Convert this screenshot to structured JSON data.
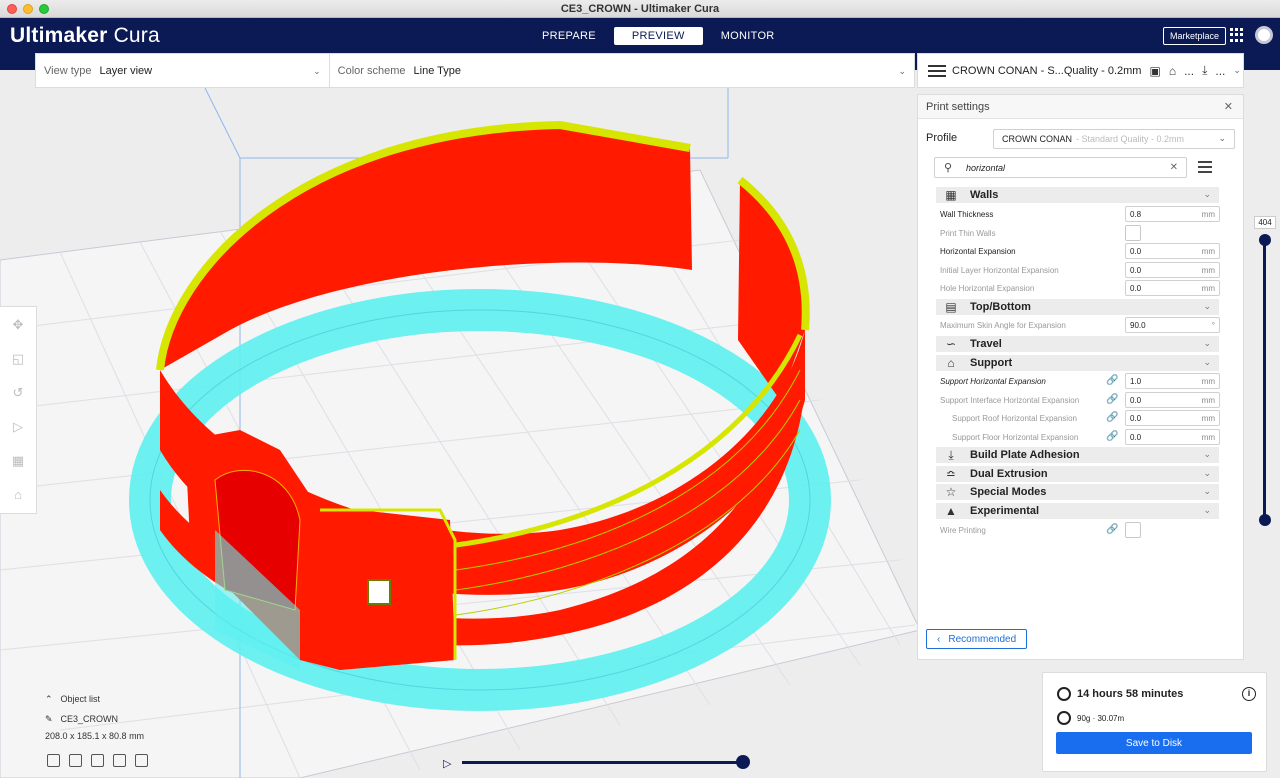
{
  "window": {
    "title": "CE3_CROWN - Ultimaker Cura"
  },
  "header": {
    "logo_brand": "Ultimaker",
    "logo_product": "Cura",
    "stages": [
      {
        "label": "PREPARE",
        "active": false
      },
      {
        "label": "PREVIEW",
        "active": true
      },
      {
        "label": "MONITOR",
        "active": false
      }
    ],
    "marketplace_label": "Marketplace"
  },
  "viewbar": {
    "view_type_label": "View type",
    "view_type_value": "Layer view",
    "color_scheme_label": "Color scheme",
    "color_scheme_value": "Line Type"
  },
  "print_header": {
    "summary": "CROWN CONAN - S...Quality - 0.2mm",
    "extra1": "...",
    "extra2": "..."
  },
  "print_settings": {
    "title": "Print settings",
    "profile_label": "Profile",
    "profile_name": "CROWN CONAN",
    "profile_sub": "- Standard Quality - 0.2mm",
    "search_value": "horizontal",
    "categories": {
      "walls": "Walls",
      "topbottom": "Top/Bottom",
      "travel": "Travel",
      "support": "Support",
      "adhesion": "Build Plate Adhesion",
      "dual": "Dual Extrusion",
      "special": "Special Modes",
      "experimental": "Experimental"
    },
    "settings": {
      "wall_thickness": {
        "label": "Wall Thickness",
        "value": "0.8",
        "unit": "mm"
      },
      "thin_walls": {
        "label": "Print Thin Walls"
      },
      "horiz_exp": {
        "label": "Horizontal Expansion",
        "value": "0.0",
        "unit": "mm"
      },
      "initial_horiz_exp": {
        "label": "Initial Layer Horizontal Expansion",
        "value": "0.0",
        "unit": "mm"
      },
      "hole_horiz_exp": {
        "label": "Hole Horizontal Expansion",
        "value": "0.0",
        "unit": "mm"
      },
      "max_skin_angle": {
        "label": "Maximum Skin Angle for Expansion",
        "value": "90.0",
        "unit": "°"
      },
      "support_horiz_exp": {
        "label": "Support Horizontal Expansion",
        "value": "1.0",
        "unit": "mm"
      },
      "support_iface_exp": {
        "label": "Support Interface Horizontal Expansion",
        "value": "0.0",
        "unit": "mm"
      },
      "support_roof_exp": {
        "label": "Support Roof Horizontal Expansion",
        "value": "0.0",
        "unit": "mm"
      },
      "support_floor_exp": {
        "label": "Support Floor Horizontal Expansion",
        "value": "0.0",
        "unit": "mm"
      },
      "wire_printing": {
        "label": "Wire Printing"
      }
    },
    "recommended_label": "Recommended"
  },
  "object_list": {
    "title": "Object list",
    "item": "CE3_CROWN",
    "dimensions": "208.0 x 185.1 x 80.8 mm"
  },
  "layer_slider": {
    "max_layer": "404"
  },
  "print_info": {
    "time": "14 hours 58 minutes",
    "material": "90g · 30.07m",
    "save_label": "Save to Disk"
  },
  "colors": {
    "header_bg": "#0b1a54",
    "accent": "#196ef0",
    "wall": "#ff0000",
    "skin": "#d7e600",
    "support": "#5ef0f0"
  }
}
